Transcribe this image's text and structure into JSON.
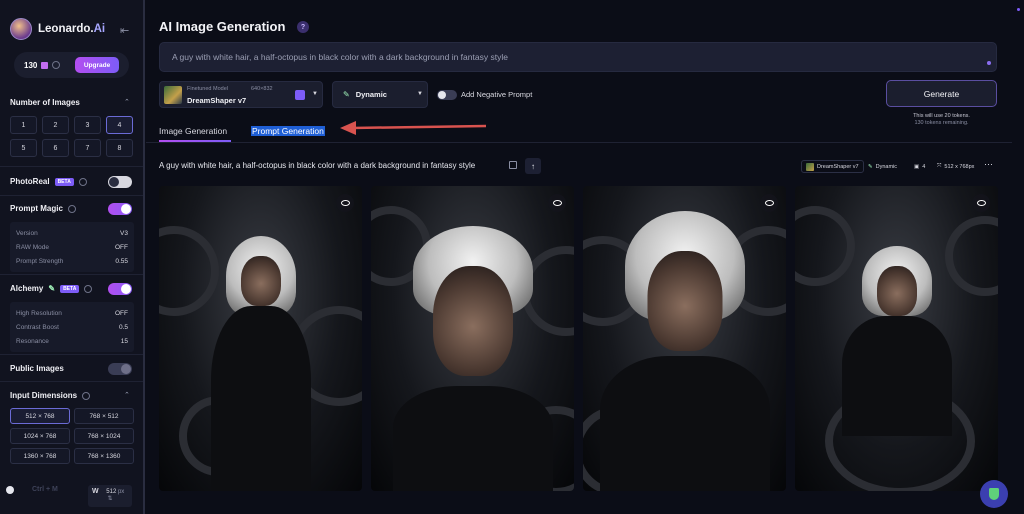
{
  "brand": {
    "name": "Leonardo.",
    "name_ai": "Ai"
  },
  "tokens": {
    "count": "130",
    "upgrade_label": "Upgrade"
  },
  "number_of_images": {
    "title": "Number of Images",
    "options": [
      "1",
      "2",
      "3",
      "4",
      "5",
      "6",
      "7",
      "8"
    ],
    "selected": "4"
  },
  "photoreal": {
    "title": "PhotoReal",
    "badge": "BETA",
    "enabled": false
  },
  "prompt_magic": {
    "title": "Prompt Magic",
    "enabled": true,
    "rows": [
      {
        "k": "Version",
        "v": "V3"
      },
      {
        "k": "RAW Mode",
        "v": "OFF"
      },
      {
        "k": "Prompt Strength",
        "v": "0.55"
      }
    ]
  },
  "alchemy": {
    "title": "Alchemy",
    "badge": "BETA",
    "enabled": true,
    "rows": [
      {
        "k": "High Resolution",
        "v": "OFF"
      },
      {
        "k": "Contrast Boost",
        "v": "0.5"
      },
      {
        "k": "Resonance",
        "v": "15"
      }
    ]
  },
  "public_images": {
    "title": "Public Images",
    "enabled": true
  },
  "input_dimensions": {
    "title": "Input Dimensions",
    "options": [
      "512 × 768",
      "768 × 512",
      "1024 × 768",
      "768 × 1024",
      "1360 × 768",
      "768 × 1360"
    ],
    "selected": "512 × 768"
  },
  "width_field": {
    "label": "W",
    "value": "512",
    "unit": "px"
  },
  "slider_overlay": "Ctrl + M",
  "header": {
    "title": "AI Image Generation",
    "help": "?"
  },
  "prompt": {
    "value": "A guy with white hair, a half-octopus in black color with a dark background in fantasy style"
  },
  "model": {
    "small_label": "Finetuned Model",
    "size": "640×832",
    "name": "DreamShaper v7"
  },
  "style": {
    "label": "Dynamic"
  },
  "negative_prompt": {
    "label": "Add Negative Prompt",
    "enabled": false
  },
  "generate": {
    "label": "Generate",
    "note1": "This will use 20 tokens.",
    "note2": "130 tokens remaining."
  },
  "tabs": [
    {
      "label": "Image Generation",
      "active": true
    },
    {
      "label": "Prompt Generation",
      "active": false
    }
  ],
  "result": {
    "prompt": "A guy with white hair, a half-octopus in black color with a dark background in fantasy style",
    "meta": {
      "model": "DreamShaper v7",
      "style": "Dynamic",
      "count": "4",
      "dims": "512 x 768px"
    }
  },
  "colors": {
    "accent": "#7d5cf7",
    "accent2": "#b34ef0",
    "bg": "#0b0d17",
    "panel": "#1b1e2e",
    "highlight": "#1f5fd6",
    "arrow": "#d9534f"
  }
}
